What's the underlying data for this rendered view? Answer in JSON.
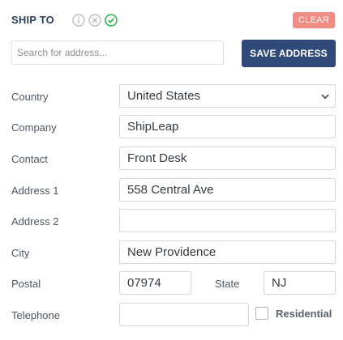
{
  "header": {
    "title": "SHIP TO",
    "clear_label": "CLEAR",
    "status_icons": [
      "info-icon",
      "cancel-icon",
      "check-icon"
    ]
  },
  "search": {
    "placeholder": "Search for address...",
    "value": "",
    "save_label": "SAVE ADDRESS"
  },
  "form": {
    "country": {
      "label": "Country",
      "value": "United States"
    },
    "company": {
      "label": "Company",
      "value": "ShipLeap"
    },
    "contact": {
      "label": "Contact",
      "value": "Front Desk"
    },
    "address1": {
      "label": "Address 1",
      "value": "558 Central Ave"
    },
    "address2": {
      "label": "Address 2",
      "value": ""
    },
    "city": {
      "label": "City",
      "value": "New Providence"
    },
    "postal": {
      "label": "Postal",
      "value": "07974"
    },
    "state": {
      "label": "State",
      "value": "NJ"
    },
    "telephone": {
      "label": "Telephone",
      "value": ""
    },
    "residential": {
      "label": "Residential",
      "checked": false
    }
  },
  "colors": {
    "title": "#2b3f5c",
    "clear_button": "#f28b82",
    "save_button": "#2f4a78",
    "check_icon": "#2bb24c",
    "muted_icon": "#b9bec4"
  }
}
